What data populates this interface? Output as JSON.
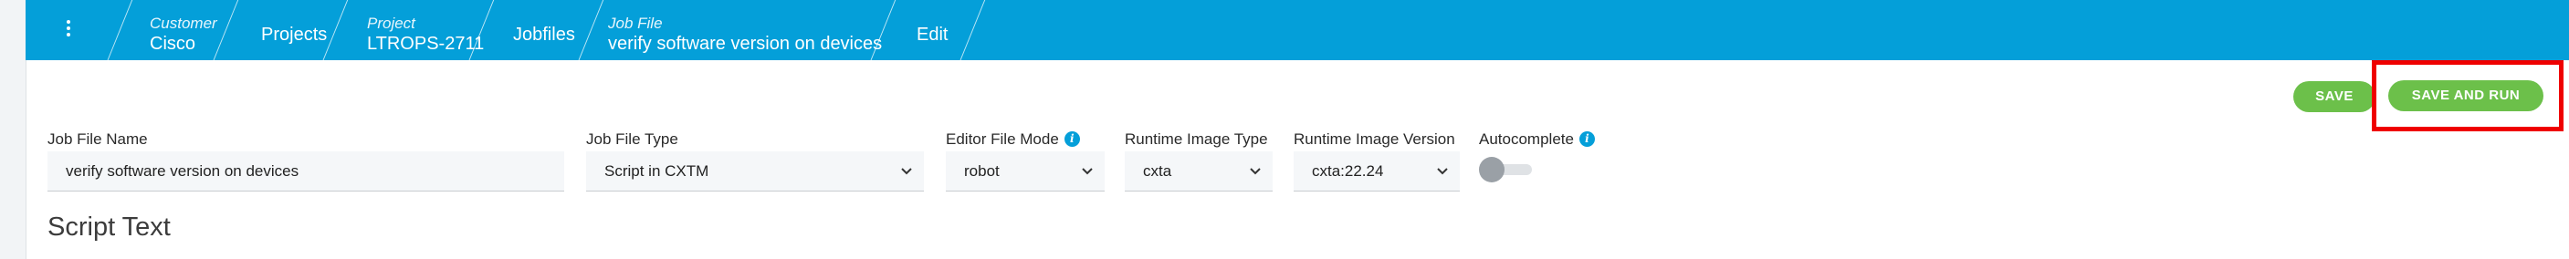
{
  "breadcrumb": {
    "menu_icon": "kebab-icon",
    "customer_label": "Customer",
    "customer_value": "Cisco",
    "projects": "Projects",
    "project_label": "Project",
    "project_value": "LTROPS-2711",
    "jobfiles": "Jobfiles",
    "jobfile_label": "Job File",
    "jobfile_value": "verify software version on devices",
    "edit": "Edit"
  },
  "actions": {
    "save_label": "SAVE",
    "save_and_run_label": "SAVE AND RUN"
  },
  "form": {
    "job_file_name_label": "Job File Name",
    "job_file_name_value": "verify software version on devices",
    "job_file_type_label": "Job File Type",
    "job_file_type_value": "Script in CXTM",
    "editor_file_mode_label": "Editor File Mode",
    "editor_file_mode_value": "robot",
    "runtime_image_type_label": "Runtime Image Type",
    "runtime_image_type_value": "cxta",
    "runtime_image_version_label": "Runtime Image Version",
    "runtime_image_version_value": "cxta:22.24",
    "autocomplete_label": "Autocomplete",
    "autocomplete_enabled": false,
    "info_icon_text": "i"
  },
  "section_title": "Script Text",
  "colors": {
    "topbar": "#049fd9",
    "button_green": "#6cc04a",
    "highlight_red": "#ef0000"
  }
}
